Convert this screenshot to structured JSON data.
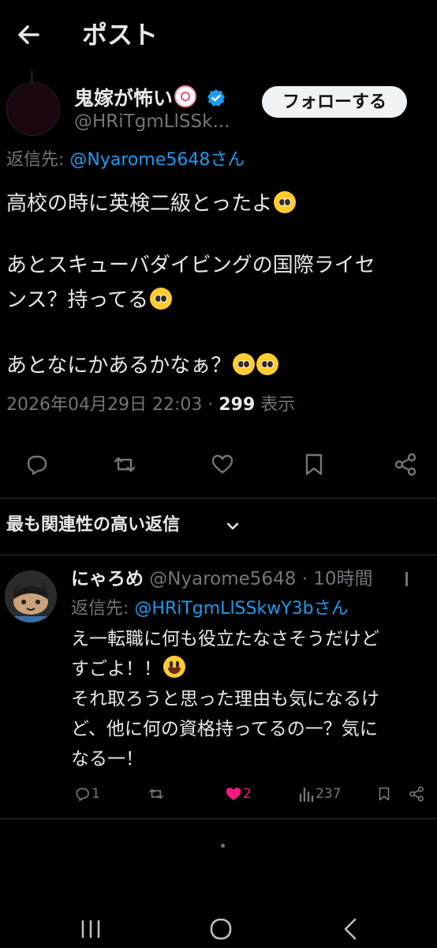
{
  "header": {
    "title": "ポスト"
  },
  "post": {
    "author_name": "鬼嫁が怖い",
    "author_handle": "@HRiTgmLlSSk...",
    "follow_label": "フォローする",
    "reply_to_label": "返信先: ",
    "reply_to_mention": "@Nyarome5648",
    "reply_to_suffix": "さん",
    "lines": [
      "高校の時に英検二級とったよ",
      "あとスキューバダイビングの国際ライセ",
      "ンス？持ってる",
      "あとなにかあるかなぁ？"
    ],
    "timestamp": "2026年04月29日 22:03 · ",
    "views_count": "299",
    "views_label": " 表示"
  },
  "actions": [
    "reply-icon",
    "retweet-icon",
    "like-icon",
    "bookmark-icon",
    "share-icon"
  ],
  "sort": {
    "label": "最も関連性の高い返信"
  },
  "reply": {
    "name": "にゃろめ",
    "handle_time": " @Nyarome5648 · 10時間",
    "reply_to_label": "返信先: ",
    "reply_to_mention": "@HRiTgmLlSSkwY3b",
    "reply_to_suffix": "さん",
    "lines": [
      "え一転職に何も役立たなさそうだけど",
      "すごよ！！",
      "それ取ろうと思った理由も気になるけ",
      "ど、他に何の資格持ってるの一？気に",
      "なる一！"
    ],
    "reply_count": "1",
    "like_count": "2",
    "view_count": "237"
  },
  "colors": {
    "accent": "#1d9bf0",
    "like": "#f91880",
    "text": "#e7e9ea",
    "muted": "#71767b"
  }
}
